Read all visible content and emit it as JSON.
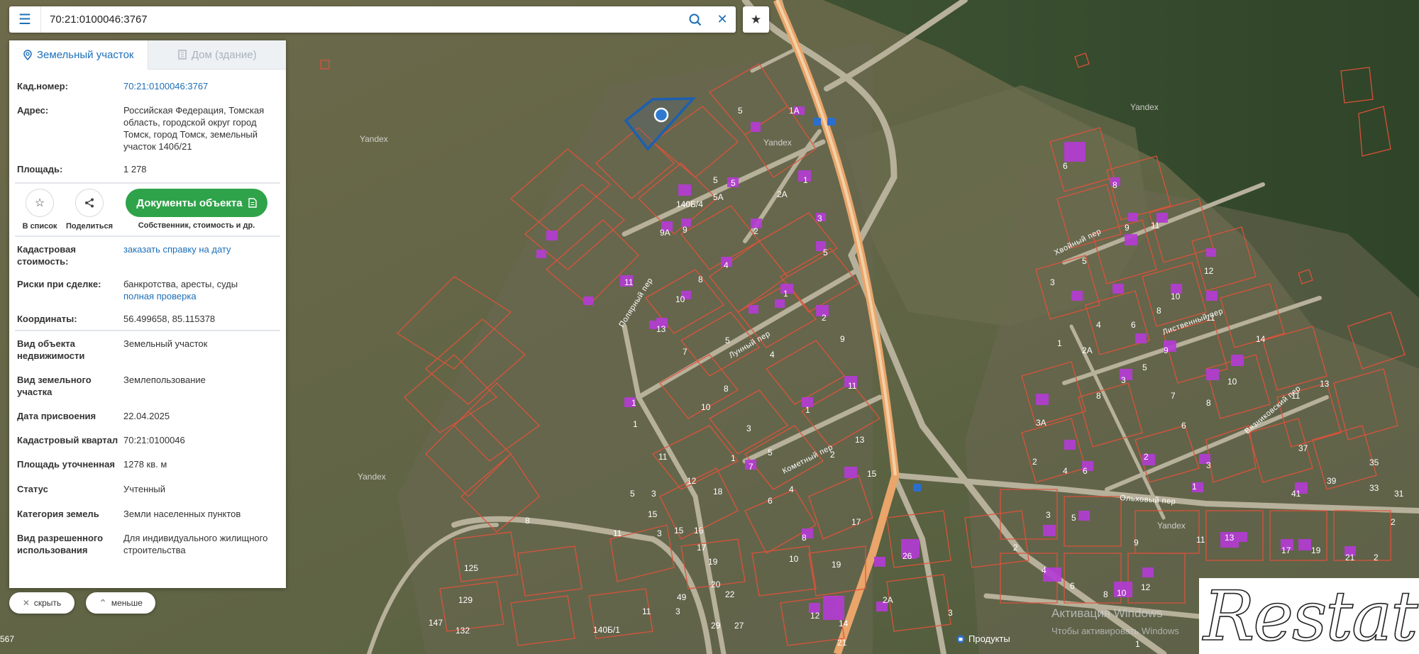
{
  "search": {
    "value": "70:21:0100046:3767"
  },
  "tabs": {
    "land": "Земельный участок",
    "house": "Дом (здание)"
  },
  "info": {
    "cad_label": "Кад.номер:",
    "cad_value": "70:21:0100046:3767",
    "addr_label": "Адрес:",
    "addr_value": "Российская Федерация, Томская область, городской округ город Томск, город Томск, земельный участок 140б/21",
    "area_label": "Площадь:",
    "area_value": "1 278"
  },
  "actions": {
    "list": "В список",
    "share": "Поделиться",
    "docs": "Документы объекта",
    "docs_sub": "Собственник, стоимость и др."
  },
  "details": {
    "cost_label": "Кадастровая стоимость:",
    "cost_link": "заказать справку на дату",
    "risk_label": "Риски при сделке:",
    "risk_value": "банкротства, аресты, суды",
    "risk_link": "полная проверка",
    "coord_label": "Координаты:",
    "coord_value": "56.499658, 85.115378",
    "type_label": "Вид объекта недвижимости",
    "type_value": "Земельный участок",
    "landtype_label": "Вид земельного участка",
    "landtype_value": "Землепользование",
    "date_label": "Дата присвоения",
    "date_value": "22.04.2025",
    "quarter_label": "Кадастровый квартал",
    "quarter_value": "70:21:0100046",
    "spec_label": "Площадь уточненная",
    "spec_value": "1278 кв. м",
    "status_label": "Статус",
    "status_value": "Учтенный",
    "cat_label": "Категория земель",
    "cat_value": "Земли населенных пунктов",
    "use_label": "Вид разрешенного использования",
    "use_value": "Для индивидуального жилищного строительства"
  },
  "buttons": {
    "hide": "скрыть",
    "less": "меньше"
  },
  "map": {
    "streets": [
      "Полярный пер",
      "Лунный пер",
      "Кометный пер",
      "Хвойный пер",
      "Лиственный пер",
      "Вязниковский пер",
      "Ольховый пер"
    ],
    "watermark": "Yandex",
    "poi": "Продукты",
    "activation": "Активация Windows",
    "activation2": "Чтобы активировать Windows"
  },
  "brand": "Restate",
  "colors": {
    "accent": "#1d6fb8",
    "docs": "#2fa34a",
    "parcel": "#e0523a",
    "building": "#b53bd6",
    "highway": "#f0a861"
  }
}
